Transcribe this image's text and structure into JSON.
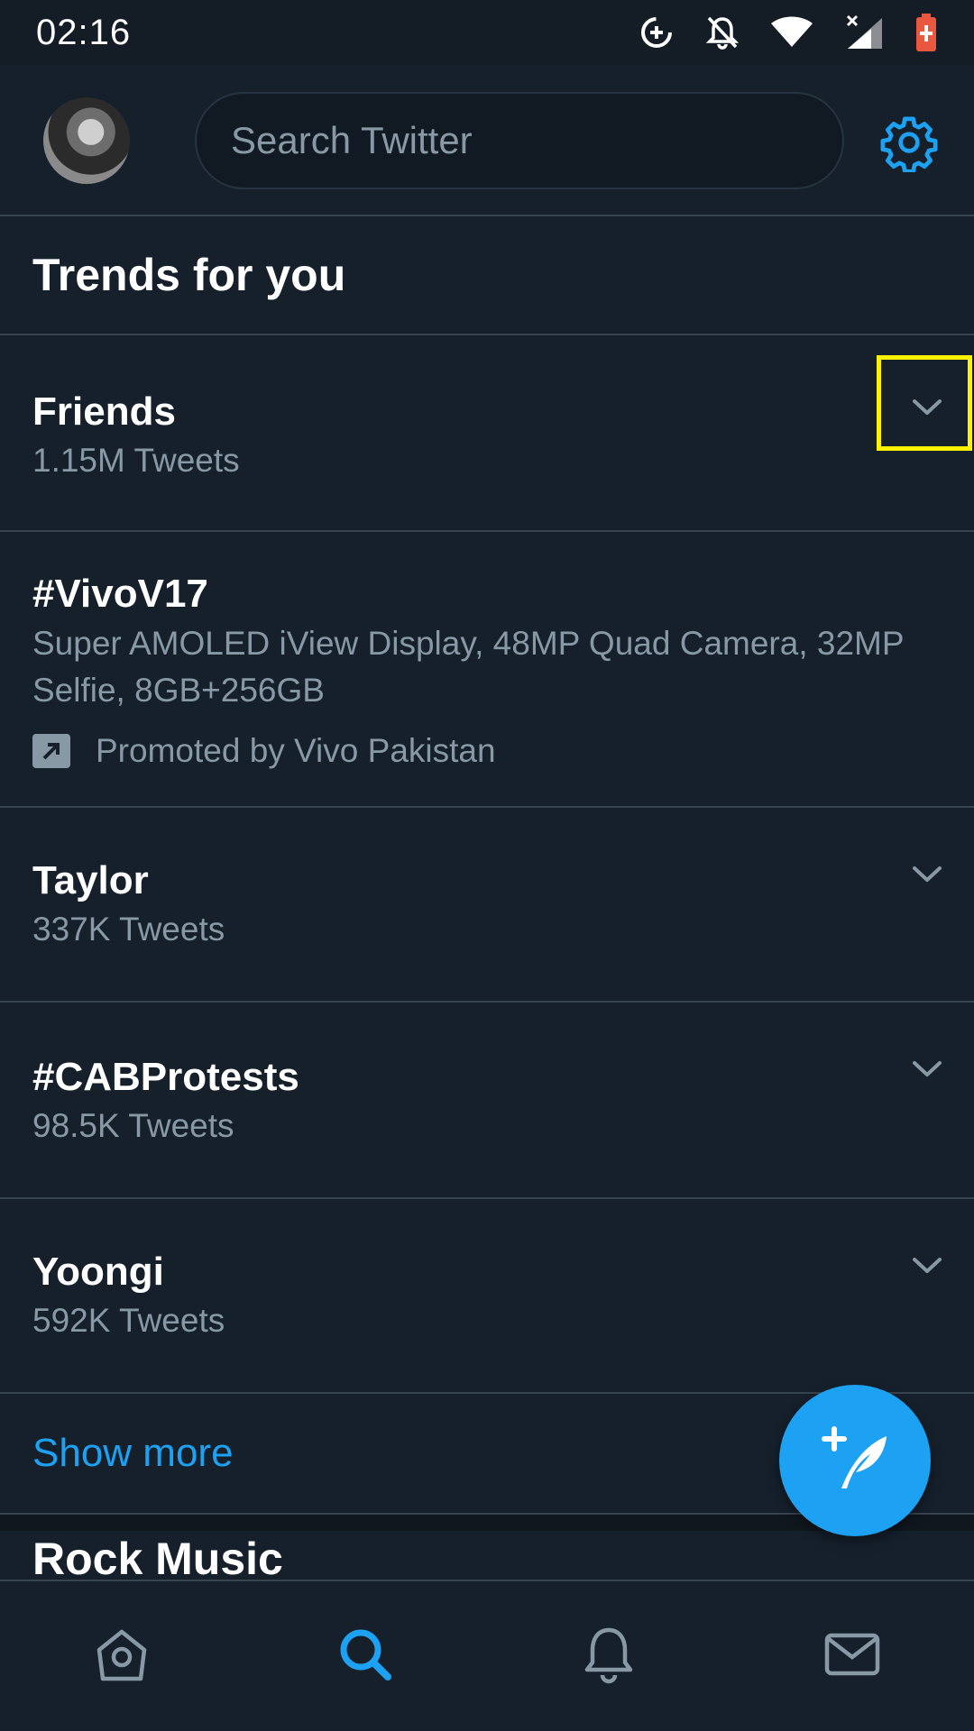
{
  "status_bar": {
    "time": "02:16",
    "icons": [
      "data-saver-icon",
      "notifications-off-icon",
      "wifi-icon",
      "cell-signal-icon",
      "battery-icon"
    ]
  },
  "header": {
    "search_placeholder": "Search Twitter",
    "avatar_icon": "avatar",
    "settings_icon": "gear-icon",
    "accent_color": "#1da1f2"
  },
  "trends_section": {
    "title": "Trends for you",
    "items": [
      {
        "title": "Friends",
        "subtitle": "1.15M Tweets"
      },
      {
        "title": "#VivoV17",
        "description": "Super AMOLED iView Display, 48MP Quad Camera, 32MP Selfie, 8GB+256GB",
        "promoted": "Promoted by Vivo Pakistan"
      },
      {
        "title": "Taylor",
        "subtitle": "337K Tweets"
      },
      {
        "title": "#CABProtests",
        "subtitle": "98.5K Tweets"
      },
      {
        "title": "Yoongi",
        "subtitle": "592K Tweets"
      }
    ],
    "show_more": "Show more"
  },
  "next_section": {
    "title": "Rock Music"
  },
  "bottom_nav": {
    "items": [
      "home-icon",
      "search-icon",
      "notifications-icon",
      "messages-icon"
    ],
    "active": "search-icon"
  },
  "colors": {
    "background": "#15202b",
    "divider": "#38444d",
    "secondary_text": "#8899a6",
    "highlight": "#fff200"
  }
}
